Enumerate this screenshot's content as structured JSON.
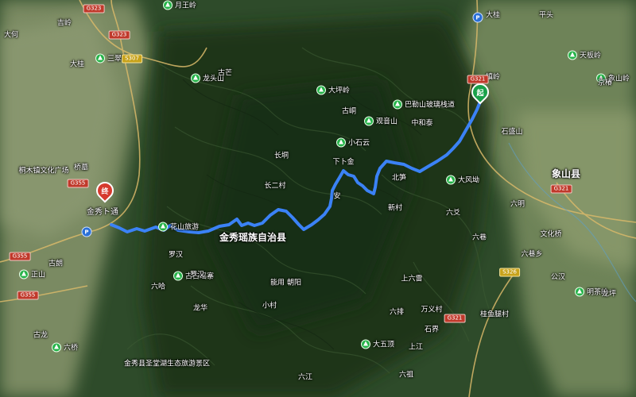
{
  "map": {
    "county_label": "金秀瑶族自治县",
    "end_county_label": "象山县",
    "colors": {
      "route": "#3b82f6",
      "start": "#1aa14a",
      "end": "#d63a2e",
      "poi": "#27b34a"
    }
  },
  "markers": {
    "start": {
      "text": "起",
      "label": ""
    },
    "end": {
      "text": "终",
      "label": "金秀ト通"
    }
  },
  "labels": {
    "l01": "大何",
    "l02": "吉岭",
    "l03": "月王岭",
    "l04": "大桂",
    "l05": "三翠岭",
    "l06": "桐木镇文化广场",
    "l07": "桥墓",
    "l08": "龙头山",
    "l09": "大坪岭",
    "l10": "巴勒山玻璃栈道",
    "l11": "观音山",
    "l12": "中和泰",
    "l13": "小石云",
    "l14": "花山旅游",
    "l15": "古古瑶寨",
    "l16": "大风坳",
    "l17": "金秀县圣堂湖生态旅游景区",
    "l18": "大五顶",
    "l19": "北笋",
    "l20": "新村",
    "l21": "六爻",
    "l22": "六巷",
    "l23": "罗汉",
    "l24": "龙华",
    "l25": "能用",
    "l26": "朝阳",
    "l27": "上六雷",
    "l28": "万义村",
    "l29": "六排",
    "l30": "六祖",
    "l31": "古朗",
    "l32": "正山",
    "l33": "六桥",
    "l34": "天板岭",
    "l35": "象山岭",
    "l36": "明茶岭",
    "l37": "桂鱼腿村",
    "l38": "龙坪",
    "l39": "上江",
    "l40": "石界",
    "l41": "古龙",
    "l42": "六哈",
    "l43": "六江",
    "l44": "小村",
    "l45": "罗汉",
    "l46": "六巷乡",
    "l47": "长二村",
    "l48": "古峒",
    "l49": "安",
    "l50": "下卜金",
    "l51": "平头",
    "l52": "镇岭",
    "l53": "石盛山",
    "l54": "文化桥",
    "l55": "大桂",
    "l56": "京椿",
    "l57": "公汉",
    "l58": "古芒",
    "l59": "六明",
    "l60": "长垌"
  },
  "roads": {
    "r1": "G323",
    "r2": "G323",
    "r3": "S307",
    "r4": "G355",
    "r5": "G355",
    "r6": "G355",
    "r7": "G321",
    "r8": "G321",
    "r9": "S326",
    "r10": "G321"
  },
  "icons": {
    "poi": "scenic-spot-icon",
    "parking": "parking-icon"
  }
}
